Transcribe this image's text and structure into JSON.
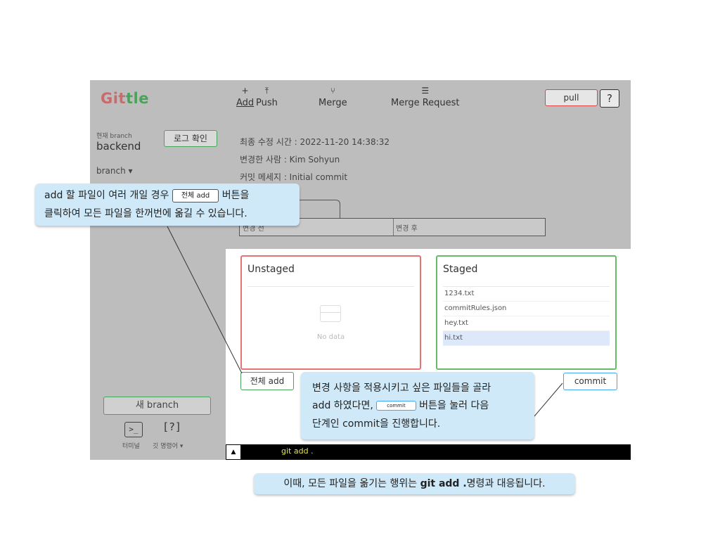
{
  "header": {
    "logo_red": "Git",
    "logo_green": "tle",
    "tools": [
      {
        "icon": "+",
        "label": "Add"
      },
      {
        "icon": "⤒",
        "label": "Push"
      },
      {
        "icon": "⑂",
        "label": "Merge"
      },
      {
        "icon": "☰",
        "label": "Merge Request"
      }
    ],
    "pull_label": "pull",
    "help_label": "?"
  },
  "sidebar": {
    "caption": "현재 branch",
    "branch": "backend",
    "log_button": "로그 확인",
    "branch_dropdown": "branch ▾",
    "new_branch": "새 branch",
    "terminal_icon": ">_",
    "command_icon": "[?]",
    "terminal_label": "터미널",
    "command_label": "깃 명령어 ▾"
  },
  "commit_info": {
    "time": "최종 수정 시간 : 2022-11-20 14:38:32",
    "author": "변경한 사람 : Kim Sohyun",
    "message": "커밋 메세지 : Initial commit",
    "diff_before": "변경 전",
    "diff_after": "변경 후"
  },
  "unstaged": {
    "title": "Unstaged",
    "empty_text": "No data"
  },
  "staged": {
    "title": "Staged",
    "files": [
      "1234.txt",
      "commitRules.json",
      "hey.txt",
      "hi.txt"
    ]
  },
  "actions": {
    "add_all": "전체 add",
    "commit": "commit"
  },
  "terminal": {
    "arrow": "▲",
    "command": "git add ."
  },
  "callouts": {
    "c1_part1": "add 할 파일이 여러 개일 경우",
    "c1_btn": "전체 add",
    "c1_part2": "버튼을",
    "c1_line2": "클릭하여 모든 파일을 한꺼번에 옮길 수 있습니다.",
    "c2_line1": "변경 사항을 적용시키고 싶은 파일들을 골라",
    "c2_part1": "add 하였다면,",
    "c2_btn": "commit",
    "c2_part2": "버튼을 눌러 다음",
    "c2_line3": "단계인 commit을 진행합니다.",
    "c3_part1": "이때, 모든 파일을 옮기는 행위는",
    "c3_bold": "git add .",
    "c3_part2": "명령과 대응됩니다."
  },
  "colors": {
    "panel_bg": "#bdbdbd",
    "callout_bg": "#cfe9f9",
    "unstaged_border": "#e57373",
    "staged_border": "#66bb6a",
    "terminal_text": "#e6e64a"
  }
}
